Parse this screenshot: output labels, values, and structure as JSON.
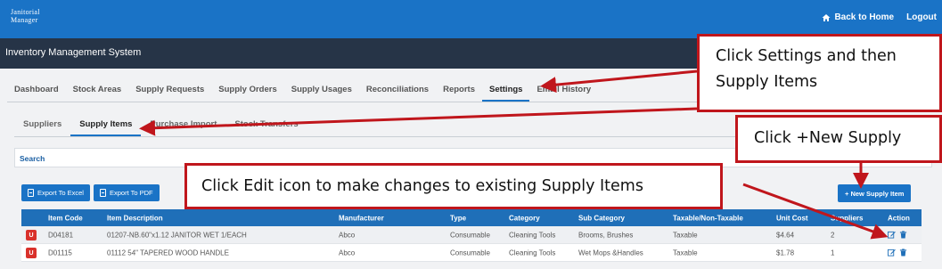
{
  "brand": {
    "logo_line1": "Janitorial",
    "logo_line2": "Manager"
  },
  "topnav": {
    "back_home": "Back to Home",
    "logout": "Logout"
  },
  "system_title": "Inventory Management System",
  "tabs": [
    {
      "label": "Dashboard"
    },
    {
      "label": "Stock Areas"
    },
    {
      "label": "Supply Requests"
    },
    {
      "label": "Supply Orders"
    },
    {
      "label": "Supply Usages"
    },
    {
      "label": "Reconciliations"
    },
    {
      "label": "Reports"
    },
    {
      "label": "Settings",
      "active": true
    },
    {
      "label": "Email History"
    }
  ],
  "subtabs": [
    {
      "label": "Suppliers"
    },
    {
      "label": "Supply Items",
      "active": true
    },
    {
      "label": "Purchase Import"
    },
    {
      "label": "Stock Transfers"
    }
  ],
  "search_label": "Search",
  "buttons": {
    "export_excel": "Export To Excel",
    "export_pdf": "Export To PDF",
    "new_supply": "+ New Supply Item"
  },
  "table": {
    "headers": [
      "Item Code",
      "Item Description",
      "Manufacturer",
      "Type",
      "Category",
      "Sub Category",
      "Taxable/Non-Taxable",
      "Unit Cost",
      "Suppliers",
      "Action"
    ],
    "rows": [
      {
        "badge": "U",
        "code": "D04181",
        "description": "01207-NB.60\"x1.12 JANITOR WET 1/EACH",
        "manufacturer": "Abco",
        "type": "Consumable",
        "category": "Cleaning Tools",
        "sub_category": "Brooms, Brushes",
        "taxable": "Taxable",
        "unit_cost": "$4.64",
        "suppliers": "2"
      },
      {
        "badge": "U",
        "code": "D01115",
        "description": "01112 54\" TAPERED WOOD HANDLE",
        "manufacturer": "Abco",
        "type": "Consumable",
        "category": "Cleaning Tools",
        "sub_category": "Wet Mops &Handles",
        "taxable": "Taxable",
        "unit_cost": "$1.78",
        "suppliers": "1"
      }
    ]
  },
  "annotations": {
    "settings_line1": "Click Settings and then",
    "settings_line2": "Supply Items",
    "new_supply": "Click +New Supply",
    "edit_icon": "Click Edit icon to make changes to existing Supply Items"
  },
  "colors": {
    "brand_blue": "#1a73c6",
    "system_bar": "#263447",
    "table_header": "#1f6fb8",
    "annotation_red": "#c0161c",
    "badge_red": "#d9312b"
  }
}
